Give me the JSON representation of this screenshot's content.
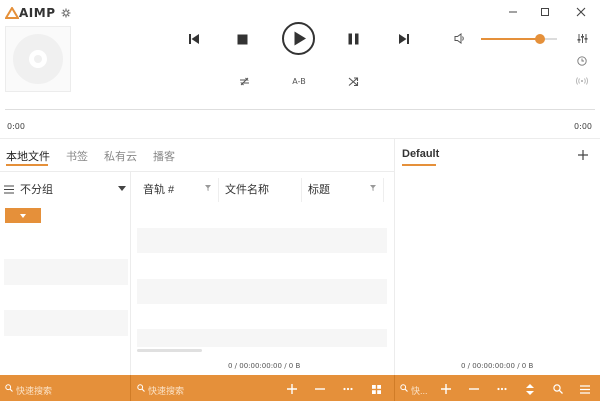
{
  "app": {
    "logo": "AIMP"
  },
  "player": {
    "ab_label": "A-B",
    "time_current": "0:00",
    "time_total": "0:00",
    "volume_percent": 78
  },
  "library": {
    "tabs": [
      {
        "label": "本地文件",
        "active": true
      },
      {
        "label": "书签",
        "active": false
      },
      {
        "label": "私有云",
        "active": false
      },
      {
        "label": "播客",
        "active": false
      }
    ],
    "group_label": "不分组",
    "columns": [
      "音轨 #",
      "文件名称",
      "标题"
    ],
    "status": "0 / 00:00:00:00 / 0 B",
    "search_placeholder_left": "快速搜索",
    "search_placeholder_mid": "快速搜索"
  },
  "playlist": {
    "tab_label": "Default",
    "status": "0 / 00:00:00:00 / 0 B",
    "search_placeholder": "快..."
  },
  "colors": {
    "accent": "#e5903a",
    "background": "#ffffff"
  }
}
